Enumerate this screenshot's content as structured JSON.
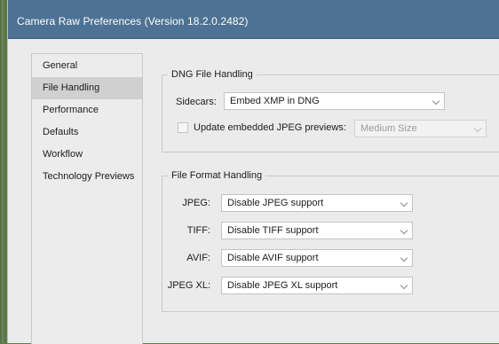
{
  "window": {
    "title": "Camera Raw Preferences  (Version 18.2.0.2482)"
  },
  "sidebar": {
    "items": [
      {
        "label": "General"
      },
      {
        "label": "File Handling"
      },
      {
        "label": "Performance"
      },
      {
        "label": "Defaults"
      },
      {
        "label": "Workflow"
      },
      {
        "label": "Technology Previews"
      }
    ],
    "selected": "File Handling"
  },
  "dng": {
    "title": "DNG File Handling",
    "sidecars_label": "Sidecars:",
    "sidecars_value": "Embed XMP in DNG",
    "update_previews_label": "Update embedded JPEG previews:",
    "update_previews_checked": false,
    "preview_size_value": "Medium Size"
  },
  "format": {
    "title": "File Format Handling",
    "rows": [
      {
        "label": "JPEG:",
        "value": "Disable JPEG support"
      },
      {
        "label": "TIFF:",
        "value": "Disable TIFF support"
      },
      {
        "label": "AVIF:",
        "value": "Disable AVIF support"
      },
      {
        "label": "JPEG XL:",
        "value": "Disable JPEG XL support"
      }
    ]
  },
  "icons": {
    "dropdown": "chevron-down-icon",
    "checkbox": "checkbox-icon"
  }
}
